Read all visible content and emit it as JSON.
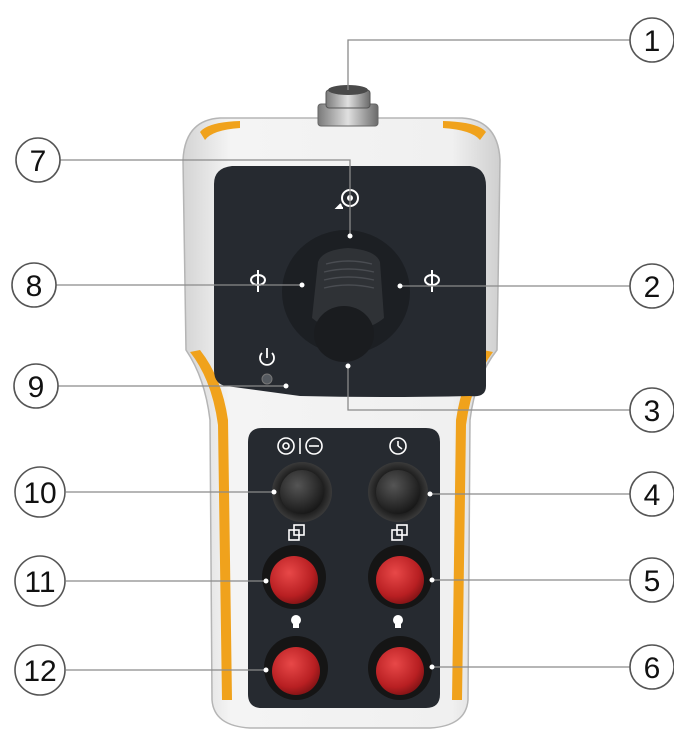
{
  "figure": {
    "subject": "handheld remote control pendant",
    "callouts": [
      {
        "number": "1",
        "part": "connector"
      },
      {
        "number": "2",
        "part": "joystick-right-rotate"
      },
      {
        "number": "3",
        "part": "joystick-down"
      },
      {
        "number": "4",
        "part": "timer-knob"
      },
      {
        "number": "5",
        "part": "right-red-button-upper"
      },
      {
        "number": "6",
        "part": "right-red-button-lower"
      },
      {
        "number": "7",
        "part": "joystick-up"
      },
      {
        "number": "8",
        "part": "joystick-left-rotate"
      },
      {
        "number": "9",
        "part": "power-indicator"
      },
      {
        "number": "10",
        "part": "mode-knob"
      },
      {
        "number": "11",
        "part": "left-red-button-upper"
      },
      {
        "number": "12",
        "part": "left-red-button-lower"
      }
    ]
  },
  "icons": {
    "top_symbol": "rotate-icon",
    "left_symbol": "rotate-left-icon",
    "right_symbol": "rotate-right-icon",
    "power_symbol": "power-icon",
    "mode_symbols": "mode-icon",
    "timer_symbol": "timer-icon",
    "window_symbol": "window-icon",
    "bulb_symbol": "bulb-icon"
  },
  "colors": {
    "housing": "#eaeaea",
    "accent_yellow": "#f0a21c",
    "panel_dark": "#262a30",
    "button_red": "#c42a2a",
    "knob_black": "#2c2c2c"
  }
}
